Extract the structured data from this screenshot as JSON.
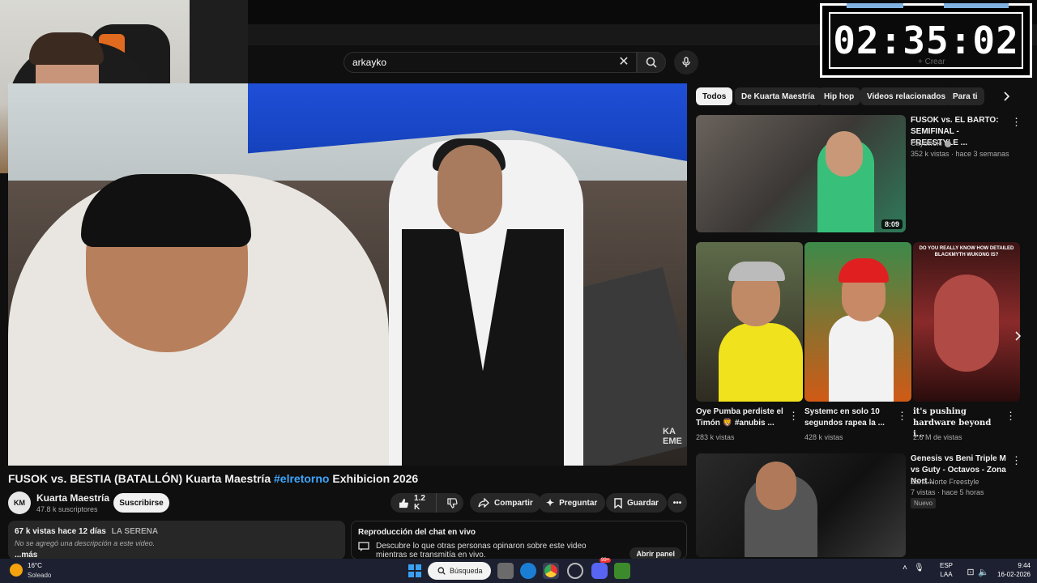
{
  "timer": {
    "value": "02:35:02",
    "crear_label": "+ Crear"
  },
  "search": {
    "value": "arkayko"
  },
  "video": {
    "title_main": "FUSOK vs. BESTIA (BATALLÓN) Kuarta Maestría",
    "title_hashtag": "#elretorno",
    "title_tail": "Exhibicion 2026",
    "watermark": "KA EME"
  },
  "channel": {
    "avatar_text": "KM",
    "name": "Kuarta Maestría",
    "subscribers": "47.8 k suscriptores",
    "subscribe_label": "Suscribirse"
  },
  "actions": {
    "likes": "1.2 K",
    "share": "Compartir",
    "ask": "Preguntar",
    "save": "Guardar"
  },
  "description": {
    "views": "67 k vistas",
    "age": "hace 12 días",
    "location": "LA SERENA",
    "text": "No se agregó una descripción a este video.",
    "more": "...más"
  },
  "chat_replay": {
    "title": "Reproducción del chat en vivo",
    "text": "Descubre lo que otras personas opinaron sobre este video mientras se transmitía en vivo.",
    "open_button": "Abrir panel"
  },
  "chips": [
    "Todos",
    "De Kuarta Maestría",
    "Hip hop",
    "Videos relacionados",
    "Para ti"
  ],
  "recommendations": [
    {
      "title": "FUSOK vs. EL BARTO: SEMIFINAL - FREESTYLE ...",
      "channel": "Cayuwoki",
      "meta": "352 k vistas · hace 3 semanas",
      "duration": "8:09"
    },
    {
      "title": "Genesis vs Beni Triple M vs Guty - Octavos - Zona Nort...",
      "channel": "Zona Norte Freestyle",
      "meta": "7 vistas · hace 5 horas",
      "badge": "Nuevo"
    }
  ],
  "shorts": [
    {
      "title": "Oye Pumba perdiste el Timón 🦁 #anubis ...",
      "views": "283 k vistas"
    },
    {
      "title": "Systemc en solo 10 segundos rapea la ...",
      "views": "428 k vistas"
    },
    {
      "title": "it's pushing hardware beyond i...",
      "views": "2.6 M de vistas",
      "thumb_caption": "DO YOU REALLY KNOW HOW DETAILED BLACKMYTH WUKONG IS?"
    }
  ],
  "taskbar": {
    "temp": "16°C",
    "condition": "Soleado",
    "search_label": "Búsqueda",
    "lang_line1": "ESP",
    "lang_line2": "LAA",
    "time": "9:44",
    "date": "16-02-2026",
    "notif_count": "99+"
  },
  "colors": {
    "accent_link": "#3ea6ff",
    "youtube_bg": "#0f0f0f",
    "chip_bg": "#272727",
    "taskbar_bg": "#1c2030"
  }
}
